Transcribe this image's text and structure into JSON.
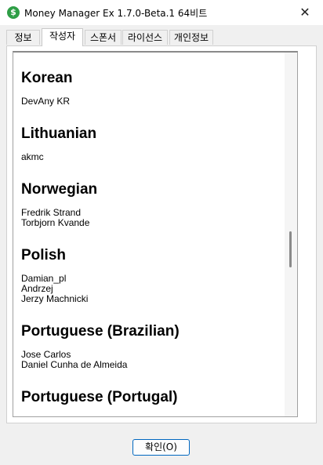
{
  "window": {
    "title": "Money Manager Ex 1.7.0-Beta.1 64비트",
    "close_symbol": "✕",
    "app_icon": "$"
  },
  "tabs": [
    {
      "label": "정보"
    },
    {
      "label": "작성자"
    },
    {
      "label": "스폰서"
    },
    {
      "label": "라이선스"
    },
    {
      "label": "개인정보"
    }
  ],
  "active_tab": "작성자",
  "translators": [
    {
      "language": "Korean",
      "names": [
        "DevAny KR"
      ]
    },
    {
      "language": "Lithuanian",
      "names": [
        "akmc"
      ]
    },
    {
      "language": "Norwegian",
      "names": [
        "Fredrik Strand",
        "Torbjorn Kvande"
      ]
    },
    {
      "language": "Polish",
      "names": [
        "Damian_pl",
        "Andrzej",
        "Jerzy Machnicki"
      ]
    },
    {
      "language": "Portuguese (Brazilian)",
      "names": [
        "Jose Carlos",
        "Daniel Cunha de Almeida"
      ]
    },
    {
      "language": "Portuguese (Portugal)",
      "names": []
    }
  ],
  "ok_button": {
    "label": "확인(O)"
  },
  "colors": {
    "accent": "#0067c0",
    "app_icon": "#2e9e46"
  }
}
